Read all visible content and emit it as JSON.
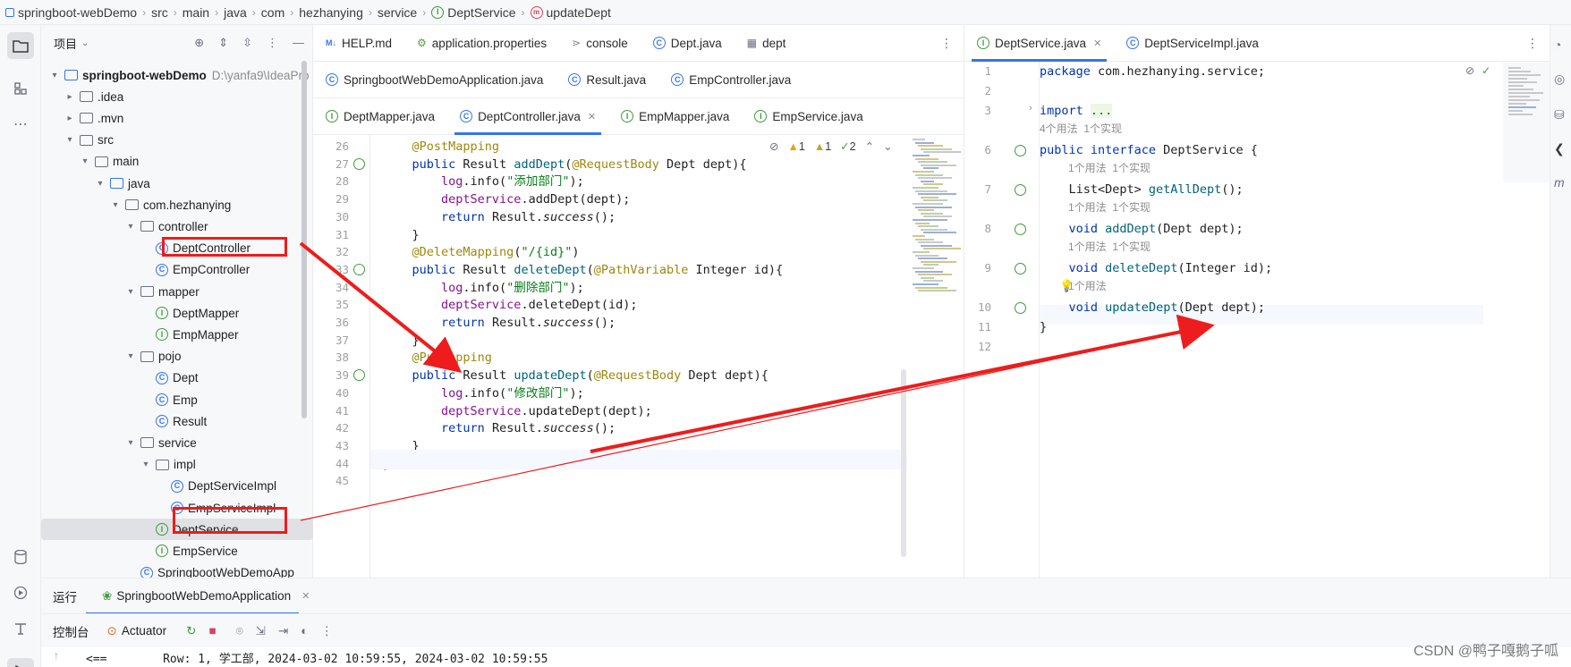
{
  "breadcrumb": [
    "springboot-webDemo",
    "src",
    "main",
    "java",
    "com",
    "hezhanying",
    "service",
    "DeptService",
    "updateDept"
  ],
  "project_panel": {
    "title": "项目",
    "tree": [
      {
        "label": "springboot-webDemo",
        "hint": "D:\\yanfa9\\IdeaPro",
        "indent": 0,
        "arrow": "▾",
        "icon": "module-folder-icon"
      },
      {
        "label": ".idea",
        "indent": 1,
        "arrow": "▸",
        "icon": "folder-icon"
      },
      {
        "label": ".mvn",
        "indent": 1,
        "arrow": "▸",
        "icon": "folder-icon"
      },
      {
        "label": "src",
        "indent": 1,
        "arrow": "▾",
        "icon": "folder-icon"
      },
      {
        "label": "main",
        "indent": 2,
        "arrow": "▾",
        "icon": "folder-icon"
      },
      {
        "label": "java",
        "indent": 3,
        "arrow": "▾",
        "icon": "source-folder-icon"
      },
      {
        "label": "com.hezhanying",
        "indent": 4,
        "arrow": "▾",
        "icon": "package-icon"
      },
      {
        "label": "controller",
        "indent": 5,
        "arrow": "▾",
        "icon": "package-icon"
      },
      {
        "label": "DeptController",
        "indent": 6,
        "arrow": "",
        "icon": "class-icon"
      },
      {
        "label": "EmpController",
        "indent": 6,
        "arrow": "",
        "icon": "class-icon"
      },
      {
        "label": "mapper",
        "indent": 5,
        "arrow": "▾",
        "icon": "package-icon"
      },
      {
        "label": "DeptMapper",
        "indent": 6,
        "arrow": "",
        "icon": "interface-icon"
      },
      {
        "label": "EmpMapper",
        "indent": 6,
        "arrow": "",
        "icon": "interface-icon"
      },
      {
        "label": "pojo",
        "indent": 5,
        "arrow": "▾",
        "icon": "package-icon"
      },
      {
        "label": "Dept",
        "indent": 6,
        "arrow": "",
        "icon": "class-icon"
      },
      {
        "label": "Emp",
        "indent": 6,
        "arrow": "",
        "icon": "class-icon"
      },
      {
        "label": "Result",
        "indent": 6,
        "arrow": "",
        "icon": "class-icon"
      },
      {
        "label": "service",
        "indent": 5,
        "arrow": "▾",
        "icon": "package-icon"
      },
      {
        "label": "impl",
        "indent": 6,
        "arrow": "▾",
        "icon": "package-icon"
      },
      {
        "label": "DeptServiceImpl",
        "indent": 7,
        "arrow": "",
        "icon": "class-icon"
      },
      {
        "label": "EmpServiceImpl",
        "indent": 7,
        "arrow": "",
        "icon": "class-icon"
      },
      {
        "label": "DeptService",
        "indent": 6,
        "arrow": "",
        "icon": "interface-icon",
        "selected": true
      },
      {
        "label": "EmpService",
        "indent": 6,
        "arrow": "",
        "icon": "interface-icon"
      },
      {
        "label": "SpringbootWebDemoApp",
        "indent": 5,
        "arrow": "",
        "icon": "spring-class-icon"
      }
    ]
  },
  "editor_left": {
    "tab_rows": [
      [
        {
          "label": "HELP.md",
          "icon": "markdown-icon"
        },
        {
          "label": "application.properties",
          "icon": "properties-icon"
        },
        {
          "label": "console",
          "icon": "console-icon"
        },
        {
          "label": "Dept.java",
          "icon": "class-icon"
        },
        {
          "label": "dept",
          "icon": "table-icon"
        }
      ],
      [
        {
          "label": "SpringbootWebDemoApplication.java",
          "icon": "spring-class-icon"
        },
        {
          "label": "Result.java",
          "icon": "class-icon"
        },
        {
          "label": "EmpController.java",
          "icon": "class-icon"
        }
      ],
      [
        {
          "label": "DeptMapper.java",
          "icon": "interface-icon"
        },
        {
          "label": "DeptController.java",
          "icon": "class-icon",
          "active": true
        },
        {
          "label": "EmpMapper.java",
          "icon": "interface-icon"
        },
        {
          "label": "EmpService.java",
          "icon": "interface-icon"
        }
      ]
    ],
    "inspections": {
      "warnings": "1",
      "weak_warnings": "1",
      "ok": "2"
    },
    "lines": [
      {
        "n": "26",
        "html": "    <span class='ann'>@PostMapping</span>"
      },
      {
        "n": "27",
        "html": "    <span class='kw'>public</span> Result <span class='fn'>addDept</span>(<span class='ann'>@RequestBody</span> Dept dept){"
      },
      {
        "n": "28",
        "html": "        <span class='fld'>log</span>.info(<span class='str'>\"添加部门\"</span>);"
      },
      {
        "n": "29",
        "html": "        <span class='fld'>deptService</span>.addDept(dept);"
      },
      {
        "n": "30",
        "html": "        <span class='kw'>return</span> Result.<span class='ital'>success</span>();"
      },
      {
        "n": "31",
        "html": "    }"
      },
      {
        "n": "32",
        "html": "    <span class='ann'>@DeleteMapping</span>(<span class='str'>\"/{id}\"</span>)"
      },
      {
        "n": "33",
        "html": "    <span class='kw'>public</span> Result <span class='fn'>deleteDept</span>(<span class='ann'>@PathVariable</span> Integer id){"
      },
      {
        "n": "34",
        "html": "        <span class='fld'>log</span>.info(<span class='str'>\"删除部门\"</span>);"
      },
      {
        "n": "35",
        "html": "        <span class='fld'>deptService</span>.deleteDept(id);"
      },
      {
        "n": "36",
        "html": "        <span class='kw'>return</span> Result.<span class='ital'>success</span>();"
      },
      {
        "n": "37",
        "html": "    }"
      },
      {
        "n": "38",
        "html": "    <span class='ann'>@PutMapping</span>"
      },
      {
        "n": "39",
        "html": "    <span class='kw'>public</span> Result <span class='fn'>updateDept</span>(<span class='ann'>@RequestBody</span> Dept dept){"
      },
      {
        "n": "40",
        "html": "        <span class='fld'>log</span>.info(<span class='str'>\"修改部门\"</span>);"
      },
      {
        "n": "41",
        "html": "        <span class='fld'>deptService</span>.updateDept(dept);"
      },
      {
        "n": "42",
        "html": "        <span class='kw'>return</span> Result.<span class='ital'>success</span>();"
      },
      {
        "n": "43",
        "html": "    }"
      },
      {
        "n": "44",
        "html": "}"
      },
      {
        "n": "45",
        "html": ""
      }
    ]
  },
  "editor_right": {
    "tabs": [
      {
        "label": "DeptService.java",
        "icon": "interface-icon",
        "active": true
      },
      {
        "label": "DeptServiceImpl.java",
        "icon": "class-icon"
      }
    ],
    "lines": [
      {
        "n": "1",
        "html": "<span class='kw'>package</span> com.hezhanying.service;",
        "hint": ""
      },
      {
        "n": "2",
        "html": "",
        "hint": ""
      },
      {
        "n": "3",
        "html": "<span class='kw'>import</span> <span class='str' style='background:#eef6e6'>...</span>",
        "hint": "4个用法  1个实现"
      },
      {
        "n": "6",
        "html": "<span class='kw'>public interface</span> DeptService {",
        "hint": "1个用法  1个实现"
      },
      {
        "n": "7",
        "html": "    List&lt;Dept&gt; <span class='fn'>getAllDept</span>();",
        "hint": "1个用法  1个实现"
      },
      {
        "n": "8",
        "html": "    <span class='kw'>void</span> <span class='fn'>addDept</span>(Dept dept);",
        "hint": "1个用法  1个实现"
      },
      {
        "n": "9",
        "html": "    <span class='kw'>void</span> <span class='fn'>deleteDept</span>(Integer id);",
        "hint": "1个用法"
      },
      {
        "n": "10",
        "html": "    <span class='kw'>void</span> <span class='fn'>updateDept</span>(Dept dept);",
        "hint": ""
      },
      {
        "n": "11",
        "html": "}",
        "hint": ""
      },
      {
        "n": "12",
        "html": "",
        "hint": ""
      }
    ]
  },
  "bottom": {
    "run_label": "运行",
    "run_tab": "SpringbootWebDemoApplication",
    "console_label": "控制台",
    "actuator_label": "Actuator",
    "console_text": "<==        Row: 1, 学工部, 2024-03-02 10:59:55, 2024-03-02 10:59:55"
  },
  "watermark": "CSDN @鸭子嘎鹅子呱",
  "colors": {
    "accent": "#3574f0",
    "annotation_red": "#ee1c1c"
  }
}
